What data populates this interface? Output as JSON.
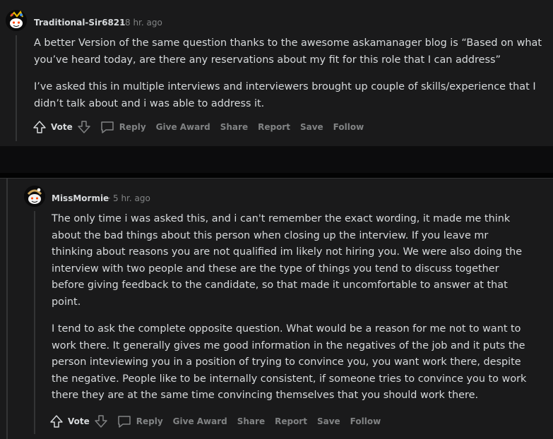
{
  "comments": [
    {
      "username": "Traditional-Sir6821",
      "time": "8 hr. ago",
      "paragraphs": [
        [
          "A better Version of the same question thanks to the awesome askamanager blog is “Based on what",
          "you’ve heard today, are there any reservations about my fit for this role that I can address”"
        ],
        [
          "I’ve asked this in multiple interviews and interviewers brought up couple of skills/experience that I",
          "didn’t talk about and i was able to address it."
        ]
      ],
      "actions": {
        "vote": "Vote",
        "reply": "Reply",
        "give_award": "Give Award",
        "share": "Share",
        "report": "Report",
        "save": "Save",
        "follow": "Follow"
      }
    },
    {
      "username": "MissMormie",
      "time": "5 hr. ago",
      "paragraphs": [
        [
          "The only time i was asked this, and i can't remember the exact wording, it made me think",
          "about the bad things about this person when closing up the interview. If you leave mr",
          "thinking about reasons you are not qualified im likely not hiring you. We were also doing the",
          "interview with two people and these are the type of things you tend to discuss together",
          "before giving feedback to the candidate, so that made it uncomfortable to answer at that",
          "point."
        ],
        [
          "I tend to ask the complete opposite question. What would be a reason for me not to want to",
          "work there. It generally gives me good information in the negatives of the job and it puts the",
          "person inteviewing you in a position of trying to convince you, you want work there, despite",
          "the negative. People like to be internally consistent, if someone tries to convince you to work",
          "there they are at the same time convincing themselves that you should work there."
        ]
      ],
      "actions": {
        "vote": "Vote",
        "reply": "Reply",
        "give_award": "Give Award",
        "share": "Share",
        "report": "Report",
        "save": "Save",
        "follow": "Follow"
      }
    }
  ],
  "separator": "·",
  "colors": {
    "background": "#1a1a1b",
    "text": "#d7dadc",
    "muted": "#818384",
    "thread_line": "#343536"
  },
  "icons": [
    "upvote-icon",
    "downvote-icon",
    "comment-icon",
    "avatar-icon"
  ]
}
